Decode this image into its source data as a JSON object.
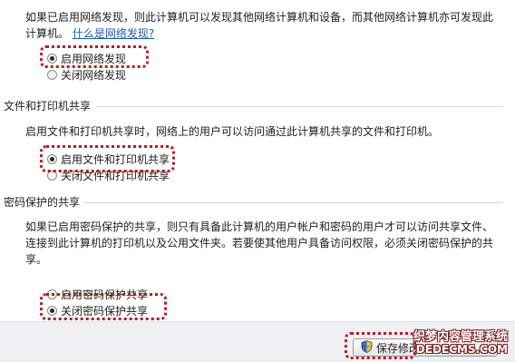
{
  "network_discovery": {
    "description": "如果已启用网络发现，则此计算机可以发现其他网络计算机和设备，而其他网络计算机亦可发现此",
    "description_line2": "计算机。",
    "help_link": "什么是网络发现?",
    "options": [
      {
        "label": "启用网络发现",
        "selected": true
      },
      {
        "label": "关闭网络发现",
        "selected": false
      }
    ]
  },
  "file_printer_sharing": {
    "title": "文件和打印机共享",
    "description": "启用文件和打印机共享时，网络上的用户可以访问通过此计算机共享的文件和打印机。",
    "options": [
      {
        "label": "启用文件和打印机共享",
        "selected": true
      },
      {
        "label": "关闭文件和打印机共享",
        "selected": false
      }
    ]
  },
  "password_sharing": {
    "title": "密码保护的共享",
    "description_lines": [
      "如果已启用密码保护的共享，则只有具备此计算机的用户帐户和密码的用户才可以访问共享文件、",
      "连接到此计算机的打印机以及公用文件夹。若要使其他用户具备访问权限，必须关闭密码保护的共",
      "享。"
    ],
    "options": [
      {
        "label": "启用密码保护共享",
        "selected": false
      },
      {
        "label": "关闭密码保护共享",
        "selected": true
      }
    ]
  },
  "footer": {
    "save_label": "保存修改",
    "icon": "uac-shield-icon"
  },
  "watermark": {
    "line1": "织梦内容管理系统",
    "line2": "DEDECMS.COM"
  },
  "colors": {
    "highlight": "#c4161c",
    "link": "#1a5fb4"
  }
}
